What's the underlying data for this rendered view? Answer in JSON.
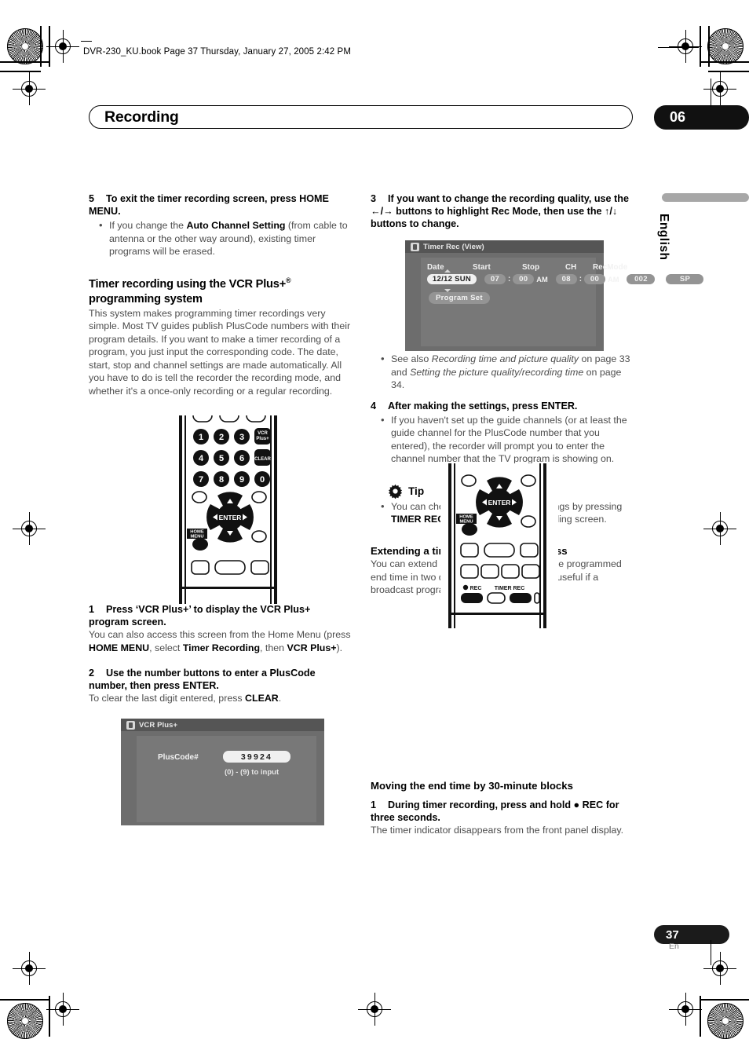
{
  "header": {
    "file_line": "DVR-230_KU.book  Page 37  Thursday, January 27, 2005  2:42 PM"
  },
  "title_bar": {
    "title": "Recording",
    "chapter": "06"
  },
  "side_tab": {
    "language": "English"
  },
  "left_column": {
    "step5": {
      "number": "5",
      "text": "To exit the timer recording screen, press HOME MENU.",
      "bullets": [
        {
          "pre": "If you change the ",
          "bold": "Auto Channel Setting",
          "post": " (from cable to antenna or the other way around), existing timer programs will be erased."
        }
      ]
    },
    "section_heading_line1": "Timer recording using the VCR Plus+",
    "section_heading_sup": "®",
    "section_heading_line2": "programming system",
    "section_body": "This system makes programming timer recordings very simple. Most TV guides publish PlusCode numbers with their program details. If you want to make a timer recording of a program, you just input the corresponding code. The date, start, stop and channel settings are made automatically. All you have to do is tell the recorder the recording mode, and whether it's a once-only recording or a regular recording.",
    "step1": {
      "number": "1",
      "text": "Press ‘VCR Plus+’ to display the VCR Plus+ program screen.",
      "body_pre": "You can also access this screen from the Home Menu (press ",
      "body_b1": "HOME MENU",
      "body_mid1": ", select ",
      "body_b2": "Timer Recording",
      "body_mid2": ", then ",
      "body_b3": "VCR Plus+",
      "body_post": ")."
    },
    "step2": {
      "number": "2",
      "text": "Use the number buttons to enter a PlusCode number, then press ENTER.",
      "body_pre": "To clear the last digit entered, press ",
      "body_b1": "CLEAR",
      "body_post": "."
    }
  },
  "right_column": {
    "step3": {
      "number": "3",
      "text_pre": "If you want to change the recording quality, use the ",
      "arrow_left": "←",
      "arrow_slash": "/",
      "arrow_right": "→",
      "text_mid": " buttons to highlight Rec Mode, then use the ",
      "arrow_up": "↑",
      "arrow_down": "↓",
      "text_post": " buttons to change."
    },
    "see_also": {
      "pre": "See also ",
      "italic1": "Recording time and picture quality",
      "mid": " on page 33 and ",
      "italic2": "Setting the picture quality/recording time",
      "post": " on page 34."
    },
    "step4": {
      "number": "4",
      "text": "After making the settings, press ENTER.",
      "bullets": [
        "If you haven't set up the guide channels (or at least the guide channel for the PlusCode number that you entered), the recorder will prompt you to enter the channel number that the TV program is showing on."
      ]
    },
    "tip": {
      "icon": "gear-icon",
      "label": "Tip",
      "bullet_pre": "You can check the timer program settings by pressing ",
      "bullet_bold": "TIMER REC",
      "bullet_post": " to display the timer recording screen."
    },
    "extending": {
      "heading": "Extending a timer recording in progress",
      "body": "You can extend a timer recording beyond the programmed end time in two different ways. This can be useful if a broadcast program overruns, for example."
    },
    "moving": {
      "heading": "Moving the end time by 30-minute blocks",
      "step1_number": "1",
      "step1_pre": "During timer recording, press and hold ",
      "step1_rec": "● REC",
      "step1_post": " for three seconds.",
      "step1_body": "The timer indicator disappears from the front panel display."
    }
  },
  "timer_osd": {
    "window_title": "Timer Rec (View)",
    "headers": [
      "Date",
      "Start",
      "Stop",
      "CH",
      "RecMode"
    ],
    "date": "12/12 SUN",
    "start_hour": "07",
    "start_min": "00",
    "start_ampm": "AM",
    "stop_hour": "08",
    "stop_min": "00",
    "stop_ampm": "AM",
    "channel": "002",
    "rec_mode": "SP",
    "program_set": "Program Set",
    "colon": ":"
  },
  "vcr_osd": {
    "window_title": "VCR Plus+",
    "field_label": "PlusCode#",
    "field_value": "39924",
    "hint": "(0) - (9) to input"
  },
  "remote_top": {
    "keys": [
      "1",
      "2",
      "3",
      "4",
      "5",
      "6",
      "7",
      "8",
      "9",
      "0"
    ],
    "vcr_plus_label_1": "VCR",
    "vcr_plus_label_2": "Plus+",
    "clear_label": "CLEAR",
    "enter_label": "ENTER",
    "home_label_1": "HOME",
    "home_label_2": "MENU"
  },
  "remote_bottom": {
    "enter_label": "ENTER",
    "home_label_1": "HOME",
    "home_label_2": "MENU",
    "rec_label": "REC",
    "timer_rec_label": "TIMER REC"
  },
  "footer": {
    "page_number": "37",
    "language_code": "En"
  },
  "colors": {
    "osd_bg": "#6d6d6d",
    "osd_inner": "#787878",
    "osd_titlebar": "#555555",
    "chip": "#949494",
    "chip_selected": "#f0f0f0",
    "accent_black": "#111111",
    "body_text": "#4d4d4d"
  }
}
